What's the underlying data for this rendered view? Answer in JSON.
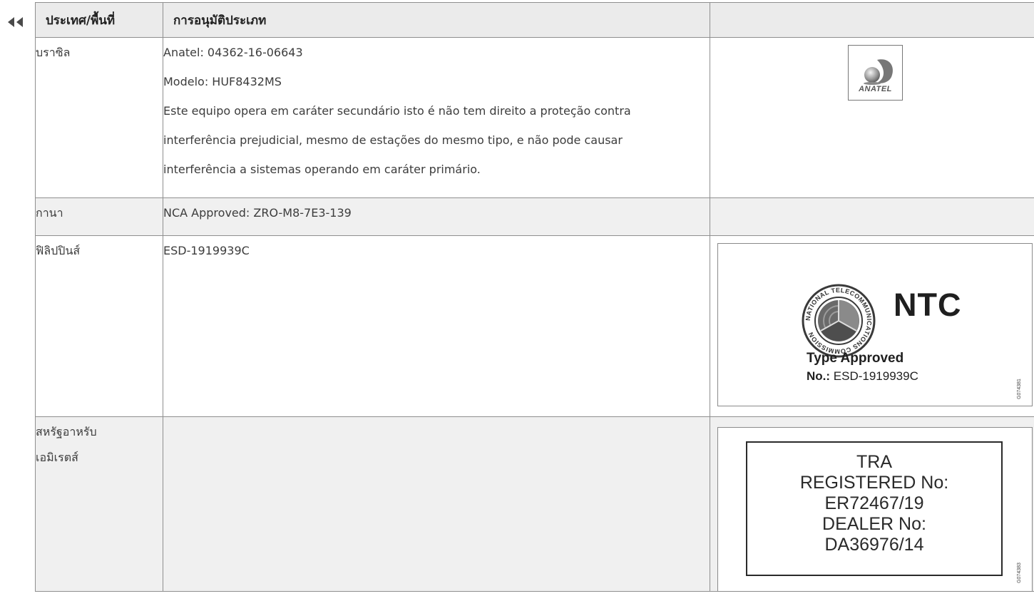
{
  "nav": {
    "back_icon": "double-chevron-left-icon"
  },
  "table": {
    "headers": [
      "ประเทศ/พื้นที่",
      "การอนุมัติประเภท",
      ""
    ],
    "rows": {
      "brazil": {
        "country": "บราซิล",
        "lines": [
          "Anatel: 04362-16-06643",
          "Modelo: HUF8432MS",
          "Este equipo opera em caráter secundário isto é não tem direito a proteção contra",
          "interferência prejudicial, mesmo de estações do mesmo tipo, e não pode causar",
          "interferência a sistemas operando em caráter primário."
        ]
      },
      "ghana": {
        "country": "กานา",
        "text": "NCA Approved: ZRO-M8-7E3-139"
      },
      "philippines": {
        "country": "ฟิลิปปินส์",
        "text": "ESD-1919939C"
      },
      "uae": {
        "country_line1": "สหรัฐอาหรับ",
        "country_line2": "เอมิเรตส์"
      }
    }
  },
  "anatel_logo": {
    "text": "ANATEL"
  },
  "ntc_label": {
    "ring_text": "NATIONAL TELECOMMUNICATIONS COMMISSION",
    "title": "NTC",
    "type_approved": "Type Approved",
    "no_label": "No.:",
    "no_value": "ESD-1919939C",
    "code": "G074381"
  },
  "tra_label": {
    "lines": [
      "TRA",
      "REGISTERED No:",
      "ER72467/19",
      "DEALER No:",
      "DA36976/14"
    ],
    "code": "G074383"
  }
}
